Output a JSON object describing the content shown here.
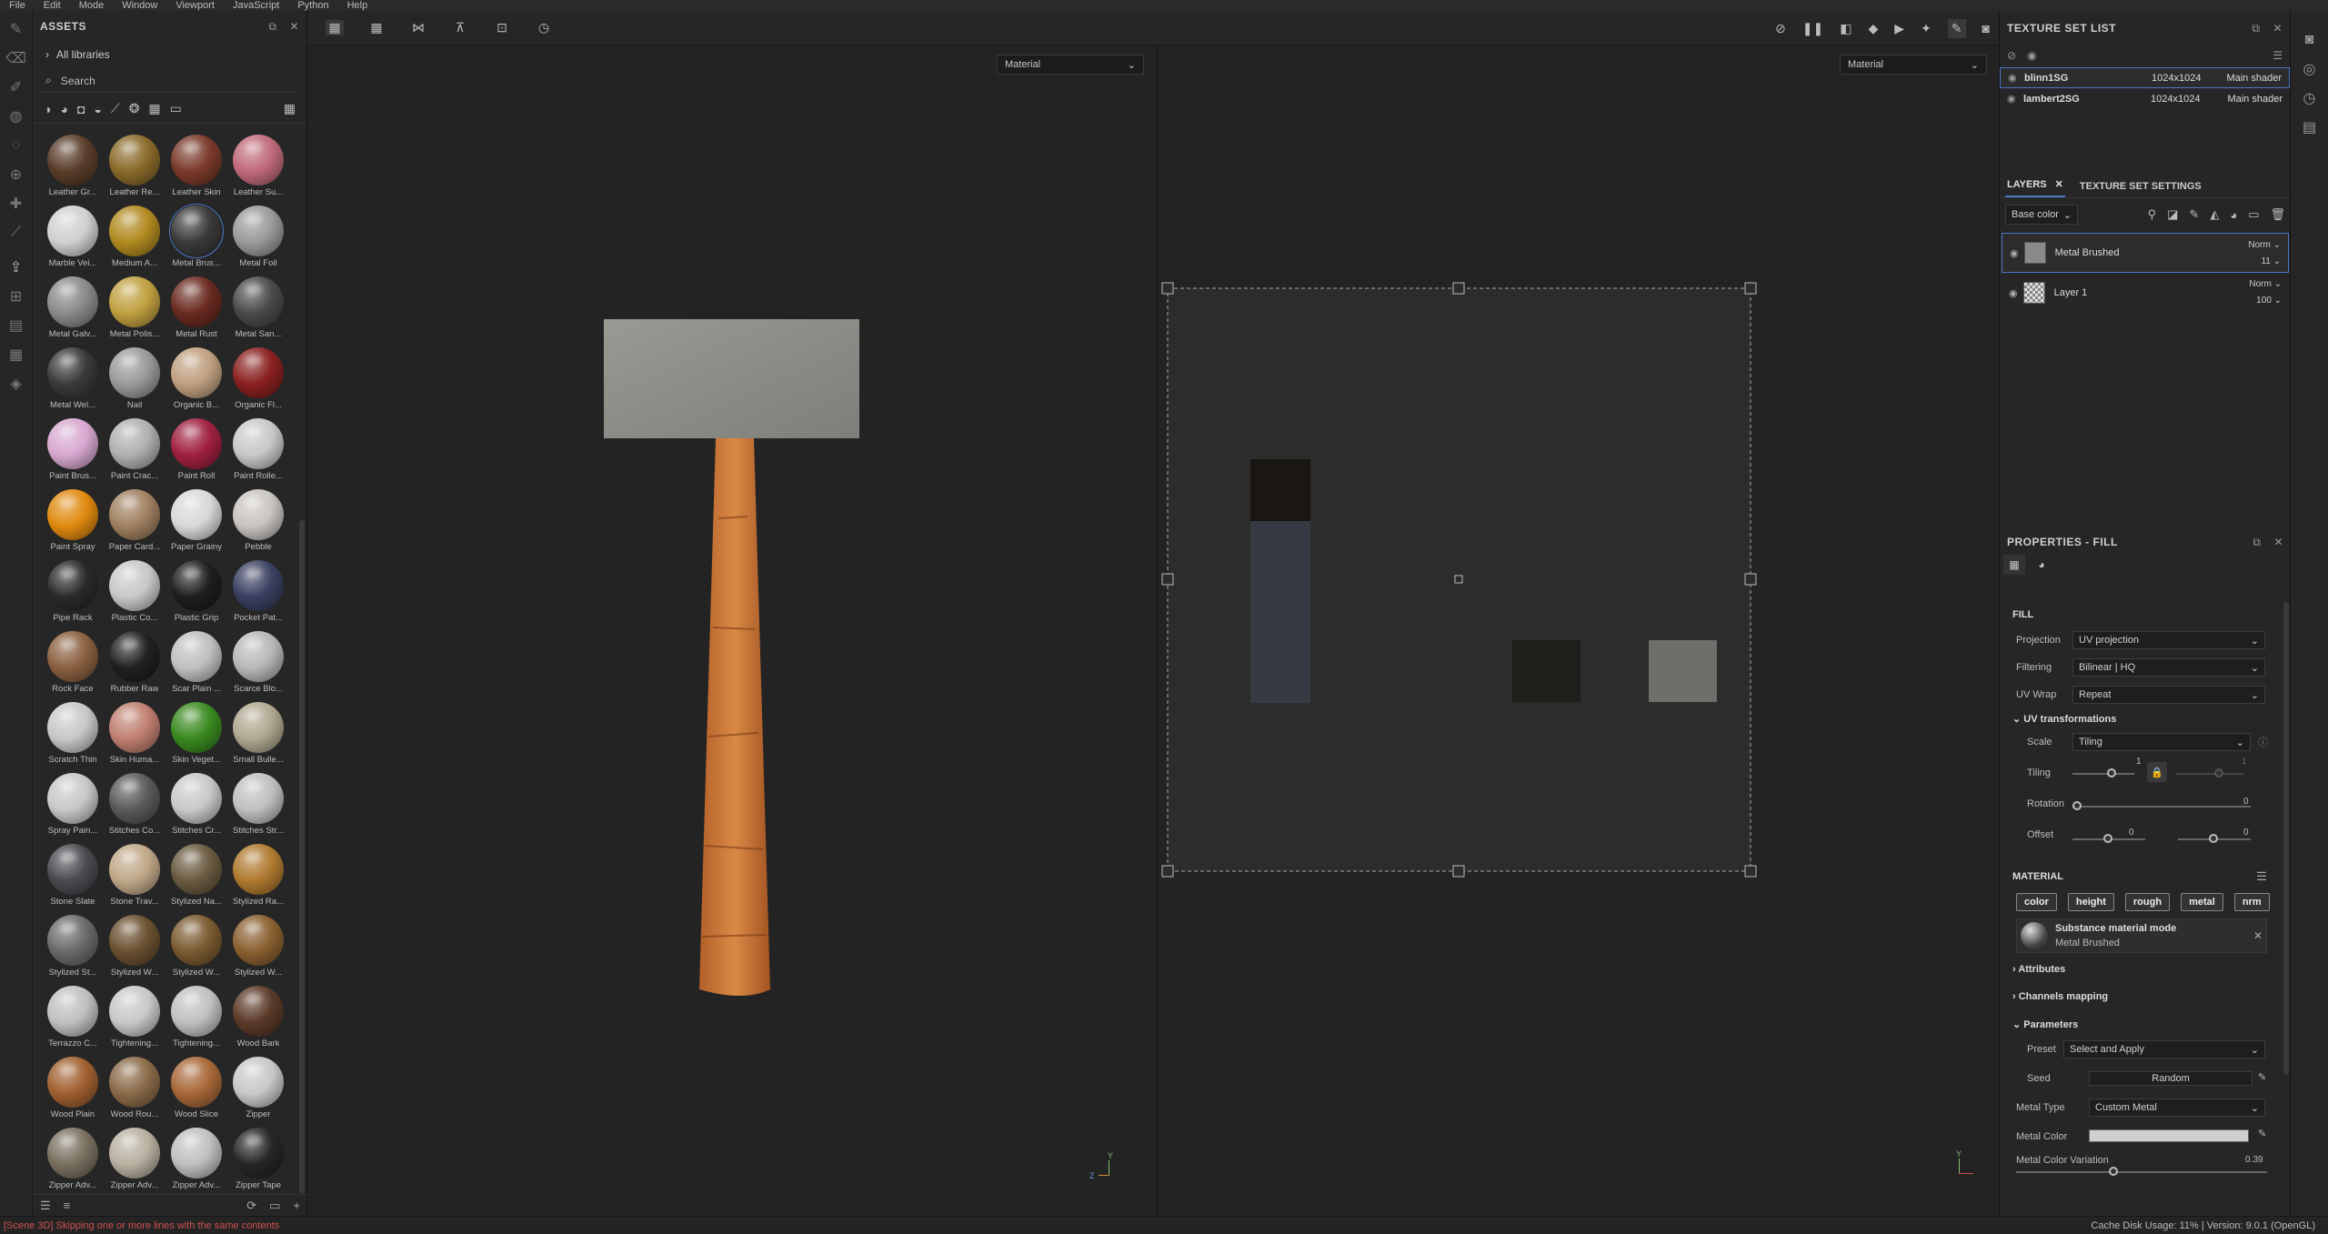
{
  "menu": [
    "File",
    "Edit",
    "Mode",
    "Window",
    "Viewport",
    "JavaScript",
    "Python",
    "Help"
  ],
  "assets": {
    "title": "ASSETS",
    "all_libraries": "All libraries",
    "search_placeholder": "Search",
    "items": [
      {
        "label": "Leather Gr...",
        "color": "#5a3d2a"
      },
      {
        "label": "Leather Re...",
        "color": "#8a6a2a"
      },
      {
        "label": "Leather Skin",
        "color": "#7a3a2a"
      },
      {
        "label": "Leather Su...",
        "color": "#c06a7a"
      },
      {
        "label": "Marble Vei...",
        "color": "#d0d0d0"
      },
      {
        "label": "Medium A...",
        "color": "#b08a20"
      },
      {
        "label": "Metal Brus...",
        "color": "#3a3a3a"
      },
      {
        "label": "Metal Foil",
        "color": "#9a9a9a"
      },
      {
        "label": "Metal Galv...",
        "color": "#8a8a8a"
      },
      {
        "label": "Metal Polis...",
        "color": "#c0a040"
      },
      {
        "label": "Metal Rust",
        "color": "#6a2a20"
      },
      {
        "label": "Metal San...",
        "color": "#4a4a48"
      },
      {
        "label": "Metal Wel...",
        "color": "#3a3a3a"
      },
      {
        "label": "Nail",
        "color": "#9a9a9a"
      },
      {
        "label": "Organic B...",
        "color": "#c0a080"
      },
      {
        "label": "Organic Fl...",
        "color": "#8a2020"
      },
      {
        "label": "Paint Brus...",
        "color": "#d8a8d0"
      },
      {
        "label": "Paint Crac...",
        "color": "#b0b0b0"
      },
      {
        "label": "Paint Roll",
        "color": "#a02040"
      },
      {
        "label": "Paint Rolle...",
        "color": "#c8c8c8"
      },
      {
        "label": "Paint Spray",
        "color": "#e08a10"
      },
      {
        "label": "Paper Card...",
        "color": "#a08060"
      },
      {
        "label": "Paper Grainy",
        "color": "#d8d8d8"
      },
      {
        "label": "Pebble",
        "color": "#c8c4c0"
      },
      {
        "label": "Pipe Rack",
        "color": "#2a2a2a"
      },
      {
        "label": "Plastic Co...",
        "color": "#c8c8c8"
      },
      {
        "label": "Plastic Grip",
        "color": "#1e1e1e"
      },
      {
        "label": "Pocket Pat...",
        "color": "#3a4060"
      },
      {
        "label": "Rock Face",
        "color": "#8a6040"
      },
      {
        "label": "Rubber Raw",
        "color": "#202020"
      },
      {
        "label": "Scar Plain ...",
        "color": "#c0c0c0"
      },
      {
        "label": "Scarce Blo...",
        "color": "#b8b8b8"
      },
      {
        "label": "Scratch Thin",
        "color": "#c8c8c8"
      },
      {
        "label": "Skin Huma...",
        "color": "#c08070"
      },
      {
        "label": "Skin Veget...",
        "color": "#3a8a20"
      },
      {
        "label": "Small Bulle...",
        "color": "#b0a890"
      },
      {
        "label": "Spray Pain...",
        "color": "#c8c8c8"
      },
      {
        "label": "Stitches Co...",
        "color": "#5a5a5a"
      },
      {
        "label": "Stitches Cr...",
        "color": "#c8c8c8"
      },
      {
        "label": "Stitches Str...",
        "color": "#c0c0c0"
      },
      {
        "label": "Stone Slate",
        "color": "#4a4a50"
      },
      {
        "label": "Stone Trav...",
        "color": "#c0a888"
      },
      {
        "label": "Stylized Na...",
        "color": "#6a5a40"
      },
      {
        "label": "Stylized Ra...",
        "color": "#b07a30"
      },
      {
        "label": "Stylized St...",
        "color": "#6a6a6a"
      },
      {
        "label": "Stylized W...",
        "color": "#6a5030"
      },
      {
        "label": "Stylized W...",
        "color": "#7a5a30"
      },
      {
        "label": "Stylized W...",
        "color": "#8a6030"
      },
      {
        "label": "Terrazzo C...",
        "color": "#c0c0c0"
      },
      {
        "label": "Tightening...",
        "color": "#c8c8c8"
      },
      {
        "label": "Tightening...",
        "color": "#c0c0c0"
      },
      {
        "label": "Wood Bark",
        "color": "#5a3a28"
      },
      {
        "label": "Wood Plain",
        "color": "#a06030"
      },
      {
        "label": "Wood Rou...",
        "color": "#8a6a48"
      },
      {
        "label": "Wood Slice",
        "color": "#a86838"
      },
      {
        "label": "Zipper",
        "color": "#c8c8c8"
      },
      {
        "label": "Zipper Adv...",
        "color": "#7a7060"
      },
      {
        "label": "Zipper Adv...",
        "color": "#b8b0a0"
      },
      {
        "label": "Zipper Adv...",
        "color": "#c0c0c0"
      },
      {
        "label": "Zipper Tape",
        "color": "#262626"
      }
    ]
  },
  "viewport": {
    "left_dropdown": "Material",
    "right_dropdown": "Material",
    "axis_y": "Y",
    "axis_z": "Z"
  },
  "texture_set_list": {
    "title": "TEXTURE SET LIST",
    "rows": [
      {
        "name": "blinn1SG",
        "res": "1024x1024",
        "shader": "Main shader"
      },
      {
        "name": "lambert2SG",
        "res": "1024x1024",
        "shader": "Main shader"
      }
    ]
  },
  "layers": {
    "tab_layers": "LAYERS",
    "tab_tss": "TEXTURE SET SETTINGS",
    "channel": "Base color",
    "rows": [
      {
        "name": "Metal Brushed",
        "blend": "Norm",
        "opacity": "11"
      },
      {
        "name": "Layer 1",
        "blend": "Norm",
        "opacity": "100"
      }
    ]
  },
  "properties": {
    "title": "PROPERTIES - FILL",
    "fill_label": "FILL",
    "projection_label": "Projection",
    "projection": "UV projection",
    "filtering_label": "Filtering",
    "filtering": "Bilinear | HQ",
    "uvwrap_label": "UV Wrap",
    "uvwrap": "Repeat",
    "uvtrans_label": "UV transformations",
    "scale_label": "Scale",
    "scale": "Tiling",
    "tiling_label": "Tiling",
    "tiling_value": "1",
    "tiling_value2": "1",
    "rotation_label": "Rotation",
    "rotation_value": "0",
    "offset_label": "Offset",
    "offset_x": "0",
    "offset_y": "0",
    "material_label": "MATERIAL",
    "chips": [
      "color",
      "height",
      "rough",
      "metal",
      "nrm"
    ],
    "mat_mode": "Substance material mode",
    "mat_name": "Metal Brushed",
    "attributes": "Attributes",
    "channels_mapping": "Channels mapping",
    "parameters": "Parameters",
    "preset_label": "Preset",
    "preset": "Select and Apply",
    "seed_label": "Seed",
    "seed_button": "Random",
    "metal_type_label": "Metal Type",
    "metal_type": "Custom Metal",
    "metal_color_label": "Metal Color",
    "metal_color_var_label": "Metal Color Variation",
    "metal_color_var": "0.39"
  },
  "status": {
    "message": "[Scene 3D] Skipping one or more lines with the same contents",
    "right": "Cache Disk Usage:   11% | Version: 9.0.1 (OpenGL)"
  }
}
